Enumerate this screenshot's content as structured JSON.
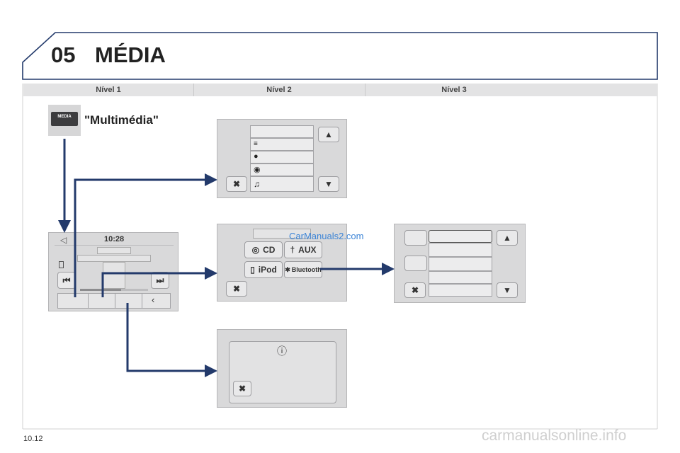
{
  "header": {
    "chapter_number": "05",
    "chapter_title": "MÉDIA"
  },
  "table_header": {
    "level1": "Nível 1",
    "level2": "Nível 2",
    "level3": "Nível 3"
  },
  "level1": {
    "media_key_label": "MEDIA",
    "multimedia_label": "\"Multimédia\""
  },
  "home_screen": {
    "clock": "10:28"
  },
  "source_screen": {
    "cd_label": "CD",
    "aux_label": "AUX",
    "ipod_label": "iPod",
    "bluetooth_label": "Bluetooth"
  },
  "watermark": "CarManuals2.com",
  "footer": {
    "page_number": "10.12",
    "site": "carmanualsonline.info"
  },
  "colors": {
    "arrow": "#233a6b",
    "frame": "#233a6b",
    "panel": "#d9d9da"
  }
}
